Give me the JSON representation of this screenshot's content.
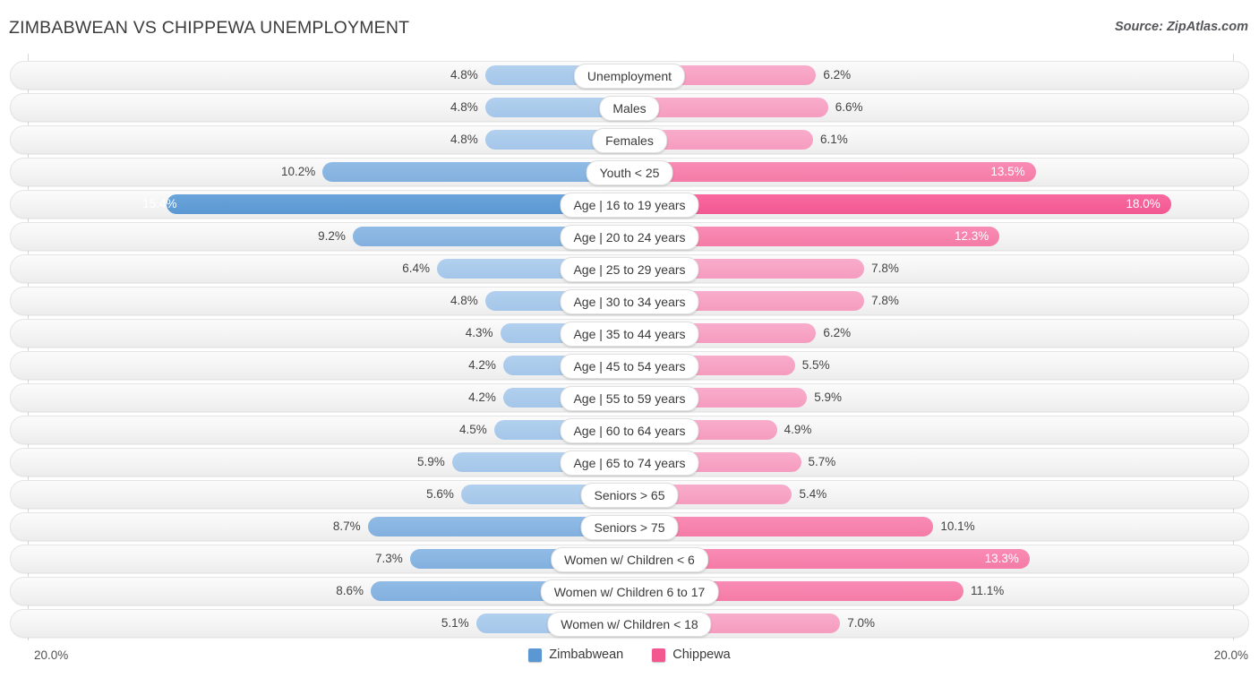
{
  "header": {
    "title": "ZIMBABWEAN VS CHIPPEWA UNEMPLOYMENT",
    "source": "Source: ZipAtlas.com"
  },
  "axis": {
    "left_tick": "20.0%",
    "right_tick": "20.0%",
    "max": 20.0
  },
  "legend": {
    "items": [
      {
        "label": "Zimbabwean",
        "color": "#5b97d2"
      },
      {
        "label": "Chippewa",
        "color": "#f2588f"
      }
    ]
  },
  "chart_data": {
    "type": "bar",
    "title": "ZIMBABWEAN VS CHIPPEWA UNEMPLOYMENT",
    "subtitle": "Source: ZipAtlas.com",
    "orientation": "horizontal-diverging",
    "xlabel": "",
    "ylabel": "",
    "xlim": [
      20.0,
      20.0
    ],
    "grid": false,
    "legend_position": "bottom-center",
    "categories": [
      "Unemployment",
      "Males",
      "Females",
      "Youth < 25",
      "Age | 16 to 19 years",
      "Age | 20 to 24 years",
      "Age | 25 to 29 years",
      "Age | 30 to 34 years",
      "Age | 35 to 44 years",
      "Age | 45 to 54 years",
      "Age | 55 to 59 years",
      "Age | 60 to 64 years",
      "Age | 65 to 74 years",
      "Seniors > 65",
      "Seniors > 75",
      "Women w/ Children < 6",
      "Women w/ Children 6 to 17",
      "Women w/ Children < 18"
    ],
    "series": [
      {
        "name": "Zimbabwean",
        "color": "#5b97d2",
        "side": "left",
        "values": [
          4.8,
          4.8,
          4.8,
          10.2,
          15.4,
          9.2,
          6.4,
          4.8,
          4.3,
          4.2,
          4.2,
          4.5,
          5.9,
          5.6,
          8.7,
          7.3,
          8.6,
          5.1
        ]
      },
      {
        "name": "Chippewa",
        "color": "#f2588f",
        "side": "right",
        "values": [
          6.2,
          6.6,
          6.1,
          13.5,
          18.0,
          12.3,
          7.8,
          7.8,
          6.2,
          5.5,
          5.9,
          4.9,
          5.7,
          5.4,
          10.1,
          13.3,
          11.1,
          7.0
        ]
      }
    ]
  },
  "rows": [
    {
      "label": "Unemployment",
      "left": "4.8%",
      "right": "6.2%",
      "lv": 4.8,
      "rv": 6.2,
      "lt": "blue-light",
      "rt": "pink-light",
      "lin": false,
      "rin": false
    },
    {
      "label": "Males",
      "left": "4.8%",
      "right": "6.6%",
      "lv": 4.8,
      "rv": 6.6,
      "lt": "blue-light",
      "rt": "pink-light",
      "lin": false,
      "rin": false
    },
    {
      "label": "Females",
      "left": "4.8%",
      "right": "6.1%",
      "lv": 4.8,
      "rv": 6.1,
      "lt": "blue-light",
      "rt": "pink-light",
      "lin": false,
      "rin": false
    },
    {
      "label": "Youth < 25",
      "left": "10.2%",
      "right": "13.5%",
      "lv": 10.2,
      "rv": 13.5,
      "lt": "blue-mid",
      "rt": "pink-mid",
      "lin": false,
      "rin": true
    },
    {
      "label": "Age | 16 to 19 years",
      "left": "15.4%",
      "right": "18.0%",
      "lv": 15.4,
      "rv": 18.0,
      "lt": "blue-dark",
      "rt": "pink-dark",
      "lin": true,
      "rin": true
    },
    {
      "label": "Age | 20 to 24 years",
      "left": "9.2%",
      "right": "12.3%",
      "lv": 9.2,
      "rv": 12.3,
      "lt": "blue-mid",
      "rt": "pink-mid",
      "lin": false,
      "rin": true
    },
    {
      "label": "Age | 25 to 29 years",
      "left": "6.4%",
      "right": "7.8%",
      "lv": 6.4,
      "rv": 7.8,
      "lt": "blue-light",
      "rt": "pink-light",
      "lin": false,
      "rin": false
    },
    {
      "label": "Age | 30 to 34 years",
      "left": "4.8%",
      "right": "7.8%",
      "lv": 4.8,
      "rv": 7.8,
      "lt": "blue-light",
      "rt": "pink-light",
      "lin": false,
      "rin": false
    },
    {
      "label": "Age | 35 to 44 years",
      "left": "4.3%",
      "right": "6.2%",
      "lv": 4.3,
      "rv": 6.2,
      "lt": "blue-light",
      "rt": "pink-light",
      "lin": false,
      "rin": false
    },
    {
      "label": "Age | 45 to 54 years",
      "left": "4.2%",
      "right": "5.5%",
      "lv": 4.2,
      "rv": 5.5,
      "lt": "blue-light",
      "rt": "pink-light",
      "lin": false,
      "rin": false
    },
    {
      "label": "Age | 55 to 59 years",
      "left": "4.2%",
      "right": "5.9%",
      "lv": 4.2,
      "rv": 5.9,
      "lt": "blue-light",
      "rt": "pink-light",
      "lin": false,
      "rin": false
    },
    {
      "label": "Age | 60 to 64 years",
      "left": "4.5%",
      "right": "4.9%",
      "lv": 4.5,
      "rv": 4.9,
      "lt": "blue-light",
      "rt": "pink-light",
      "lin": false,
      "rin": false
    },
    {
      "label": "Age | 65 to 74 years",
      "left": "5.9%",
      "right": "5.7%",
      "lv": 5.9,
      "rv": 5.7,
      "lt": "blue-light",
      "rt": "pink-light",
      "lin": false,
      "rin": false
    },
    {
      "label": "Seniors > 65",
      "left": "5.6%",
      "right": "5.4%",
      "lv": 5.6,
      "rv": 5.4,
      "lt": "blue-light",
      "rt": "pink-light",
      "lin": false,
      "rin": false
    },
    {
      "label": "Seniors > 75",
      "left": "8.7%",
      "right": "10.1%",
      "lv": 8.7,
      "rv": 10.1,
      "lt": "blue-mid",
      "rt": "pink-mid",
      "lin": false,
      "rin": false
    },
    {
      "label": "Women w/ Children < 6",
      "left": "7.3%",
      "right": "13.3%",
      "lv": 7.3,
      "rv": 13.3,
      "lt": "blue-mid",
      "rt": "pink-mid",
      "lin": false,
      "rin": true
    },
    {
      "label": "Women w/ Children 6 to 17",
      "left": "8.6%",
      "right": "11.1%",
      "lv": 8.6,
      "rv": 11.1,
      "lt": "blue-mid",
      "rt": "pink-mid",
      "lin": false,
      "rin": false
    },
    {
      "label": "Women w/ Children < 18",
      "left": "5.1%",
      "right": "7.0%",
      "lv": 5.1,
      "rv": 7.0,
      "lt": "blue-light",
      "rt": "pink-light",
      "lin": false,
      "rin": false
    }
  ]
}
